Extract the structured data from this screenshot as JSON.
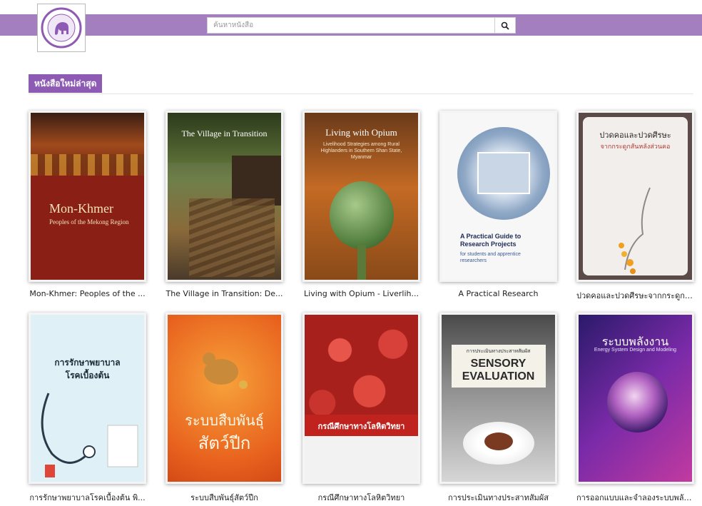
{
  "search": {
    "placeholder": "ค้นหาหนังสือ"
  },
  "section": {
    "title": "หนังสือใหม่ล่าสุด"
  },
  "books": [
    {
      "title": "Mon-Khmer: Peoples of the ...",
      "cover_title": "Mon-Khmer",
      "cover_subtitle": "Peoples of the Mekong Region"
    },
    {
      "title": "The Village in Transition: De...",
      "cover_title": "The Village in Transition"
    },
    {
      "title": "Living with Opium - Liverlih...",
      "cover_title": "Living with Opium",
      "cover_subtitle": "Livelihood Strategies among Rural Highlanders in Southern Shan State, Myanmar"
    },
    {
      "title": "A Practical Research",
      "cover_title": "A Practical Guide to Research Projects",
      "cover_subtitle": "for students and apprentice researchers"
    },
    {
      "title": "ปวดคอและปวดศีรษะจากกระดูกสั...",
      "cover_title": "ปวดคอและปวดศีรษะ",
      "cover_subtitle": "จากกระดูกสันหลังส่วนคอ"
    },
    {
      "title": "การรักษาพยาบาลโรคเบื้องต้น พิ...",
      "cover_title": "การรักษาพยาบาล",
      "cover_subtitle": "โรคเบื้องต้น"
    },
    {
      "title": "ระบบสืบพันธุ์สัตว์ปีก",
      "cover_title": "ระบบสืบพันธุ์",
      "cover_subtitle": "สัตว์ปีก"
    },
    {
      "title": "กรณีศึกษาทางโลหิตวิทยา",
      "cover_title": "กรณีศึกษาทางโลหิตวิทยา"
    },
    {
      "title": "การประเมินทางประสาทสัมผัส",
      "cover_title": "SENSORY EVALUATION",
      "cover_subtitle": "การประเมินทางประสาทสัมผัส"
    },
    {
      "title": "การออกแบบและจำลองระบบพลัง...",
      "cover_title": "ระบบพลังงาน",
      "cover_subtitle": "Energy System Design and Modeling"
    }
  ],
  "colors": {
    "brand": "#a47fc0",
    "section": "#8e5bb4"
  }
}
